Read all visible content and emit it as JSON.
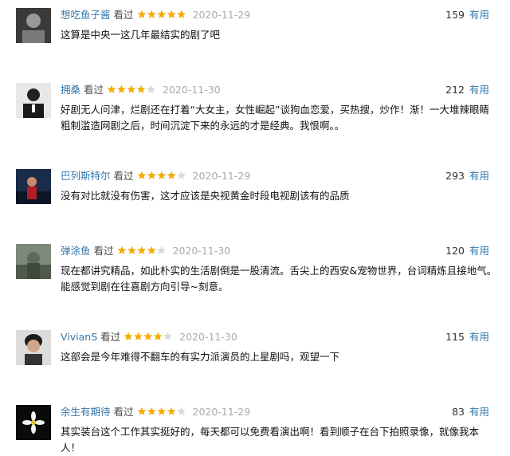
{
  "reviews": [
    {
      "user": "想吃鱼子酱",
      "watched": "看过",
      "rating": 5,
      "date": "2020-11-29",
      "votes": "159",
      "useful": "有用",
      "text": "这算是中央一这几年最结实的剧了吧"
    },
    {
      "user": "拥桑",
      "watched": "看过",
      "rating": 4,
      "date": "2020-11-30",
      "votes": "212",
      "useful": "有用",
      "text": "好剧无人问津，烂剧还在打着“大女主，女性崛起”谈狗血恋爱，买热搜，炒作！渐！一大堆辣眼睛粗制滥造网剧之后，时间沉淀下来的永远的才是经典。我恨啊。。"
    },
    {
      "user": "巴列斯特尔",
      "watched": "看过",
      "rating": 4,
      "date": "2020-11-29",
      "votes": "293",
      "useful": "有用",
      "text": "没有对比就没有伤害，这才应该是央视黄金时段电视剧该有的品质"
    },
    {
      "user": "弹涂鱼",
      "watched": "看过",
      "rating": 4,
      "date": "2020-11-30",
      "votes": "120",
      "useful": "有用",
      "text": "现在都讲究精品，如此朴实的生活剧倒是一股清流。舌尖上的西安&宠物世界，台词精炼且接地气。能感觉到剧在往喜剧方向引导~刻意。"
    },
    {
      "user": "VivianS",
      "watched": "看过",
      "rating": 4,
      "date": "2020-11-30",
      "votes": "115",
      "useful": "有用",
      "text": "这部会是今年难得不翻车的有实力派演员的上星剧吗，观望一下"
    },
    {
      "user": "余生有期待",
      "watched": "看过",
      "rating": 4,
      "date": "2020-11-29",
      "votes": "83",
      "useful": "有用",
      "text": "其实装台这个工作其实挺好的，每天都可以免费看演出啊！看到顺子在台下拍照录像，就像我本人！"
    }
  ],
  "colors": {
    "link": "#3377aa",
    "star": "#f6ab00",
    "star_empty": "#d8d8d8",
    "date": "#aaaaaa"
  }
}
